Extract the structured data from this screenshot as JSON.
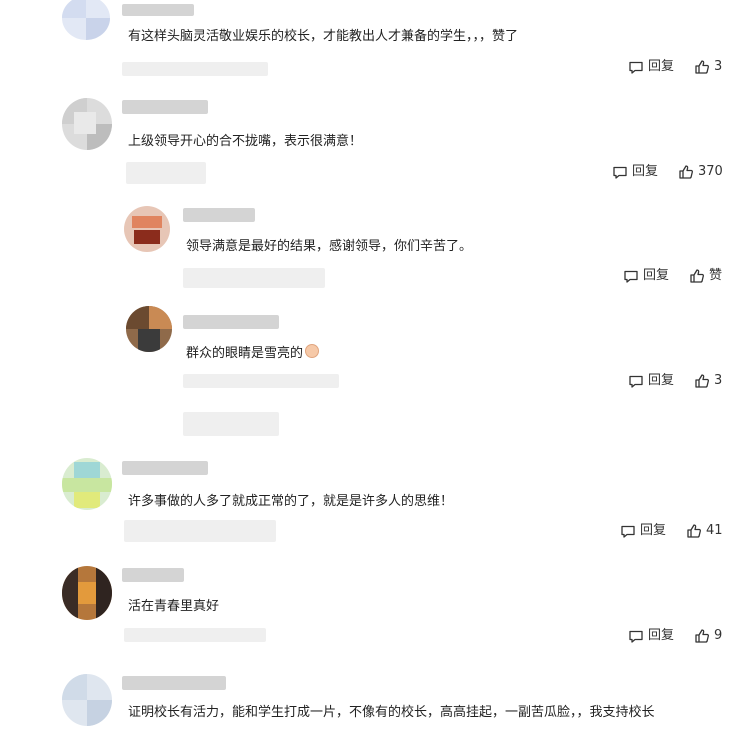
{
  "comments": [
    {
      "text": "有这样头脑灵活敬业娱乐的校长，才能教出人才兼备的学生，，，赞了",
      "reply_label": "回复",
      "like_count": "3"
    },
    {
      "text": "上级领导开心的合不拢嘴，表示很满意！",
      "reply_label": "回复",
      "like_count": "370",
      "replies": [
        {
          "text": "领导满意是最好的结果，感谢领导，你们辛苦了。",
          "reply_label": "回复",
          "like_label": "赞"
        },
        {
          "text": "群众的眼睛是雪亮的",
          "emoji": "pinching-hand-emoji",
          "reply_label": "回复",
          "like_count": "3"
        }
      ]
    },
    {
      "text": "许多事做的人多了就成正常的了，就是是许多人的思维！",
      "reply_label": "回复",
      "like_count": "41"
    },
    {
      "text": "活在青春里真好",
      "reply_label": "回复",
      "like_count": "9"
    },
    {
      "text": "证明校长有活力，能和学生打成一片，不像有的校长，高高挂起，一副苦瓜脸，，我支持校长"
    }
  ],
  "icons": {
    "reply": "comment-bubble-icon",
    "like": "thumbs-up-icon"
  }
}
